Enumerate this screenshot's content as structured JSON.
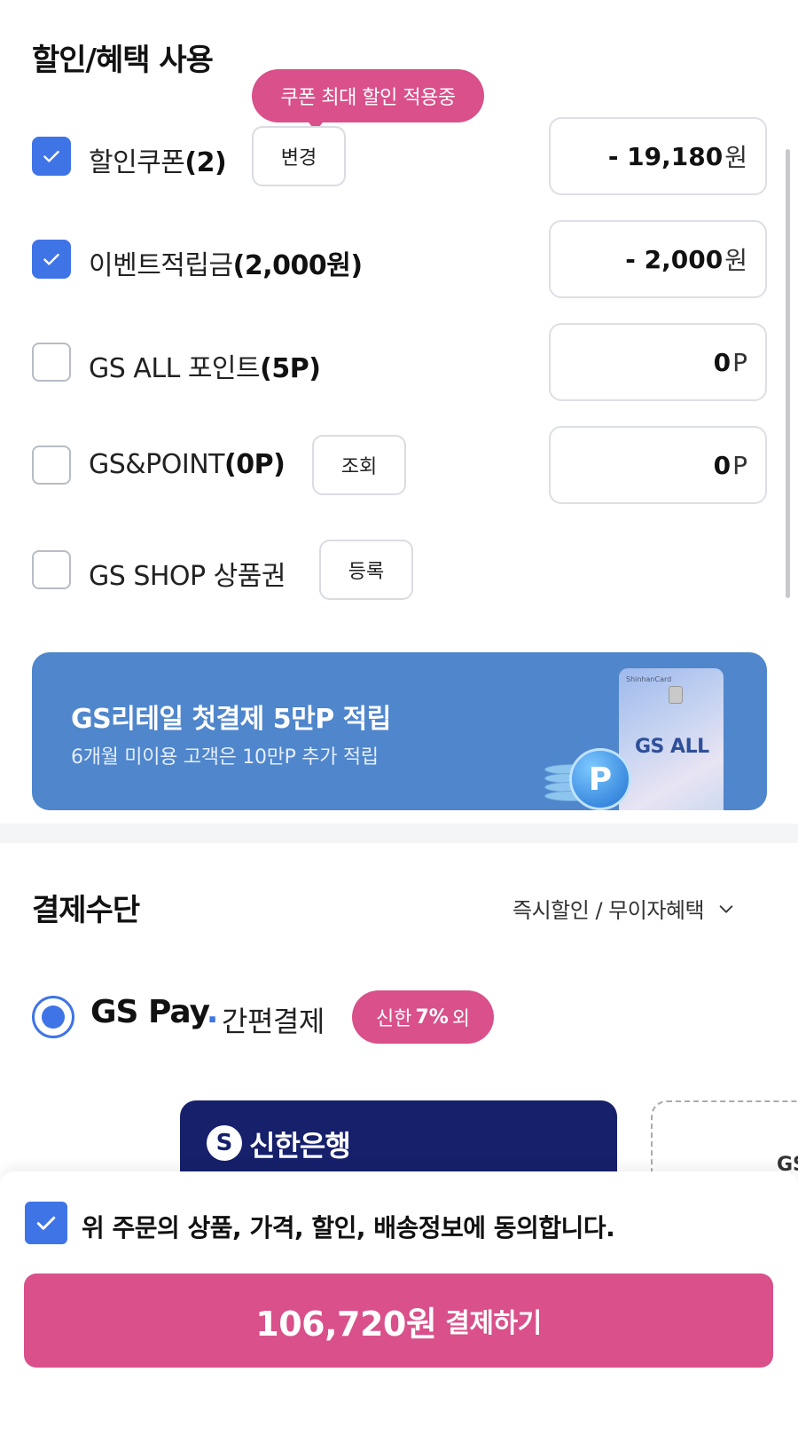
{
  "discount": {
    "title": "할인/혜택 사용",
    "tooltip": "쿠폰 최대 할인 적용중",
    "rows": [
      {
        "label": "할인쿠폰",
        "label_bold": "(2)",
        "checked": true,
        "button": "변경",
        "amount": "- 19,180",
        "unit": "원"
      },
      {
        "label": "이벤트적립금",
        "label_bold": "(2,000원)",
        "checked": true,
        "button": "",
        "amount": "- 2,000",
        "unit": "원"
      },
      {
        "label": "GS ALL 포인트",
        "label_bold": "(5P)",
        "checked": false,
        "button": "",
        "amount": "0",
        "unit": "P"
      },
      {
        "label": "GS&POINT",
        "label_bold": "(0P)",
        "checked": false,
        "button": "조회",
        "amount": "0",
        "unit": "P"
      },
      {
        "label": "GS SHOP 상품권",
        "label_bold": "",
        "checked": false,
        "button": "등록",
        "amount": "",
        "unit": ""
      }
    ]
  },
  "banner": {
    "title": "GS리테일 첫결제 5만P 적립",
    "subtitle": "6개월 미이용 고객은 10만P 추가 적립",
    "card_brand": "ShinhanCard",
    "card_logo": "GS ALL",
    "coin_letter": "P"
  },
  "payment": {
    "title": "결제수단",
    "dropdown_label": "즉시할인 / 무이자혜택",
    "method_logo": "GS Pay",
    "method_logo_dot": ".",
    "method_label": "간편결제",
    "promo_prefix": "신한",
    "promo_bold": "7%",
    "promo_suffix": "외",
    "bank_logo_letter": "S",
    "bank_name": "신한은행",
    "add_card_partial": "GS"
  },
  "checkout": {
    "agree_text": "위 주문의 상품, 가격, 할인, 배송정보에 동의합니다.",
    "agree_checked": true,
    "pay_amount": "106,720원",
    "pay_label": "결제하기"
  },
  "colors": {
    "accent_blue": "#3f74e6",
    "accent_pink": "#d9508a",
    "banner_blue": "#4f86cc",
    "bank_navy": "#16206b"
  }
}
